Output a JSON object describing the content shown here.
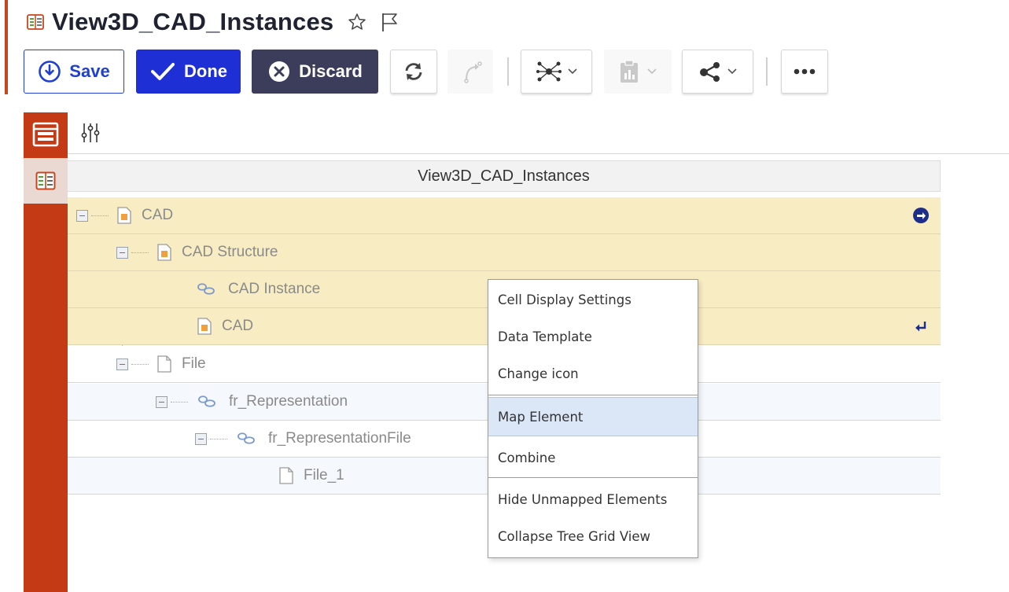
{
  "header": {
    "title": "View3D_CAD_Instances"
  },
  "toolbar": {
    "save_label": "Save",
    "done_label": "Done",
    "discard_label": "Discard"
  },
  "grid": {
    "column_header": "View3D_CAD_Instances",
    "rows": [
      {
        "label": "CAD",
        "level": 0,
        "icon": "cad-file-icon",
        "style": "yellow",
        "action": "navigate-circle-icon"
      },
      {
        "label": "CAD Structure",
        "level": 1,
        "icon": "cad-file-icon",
        "style": "yellow"
      },
      {
        "label": "CAD Instance",
        "level": 2,
        "icon": "relationship-icon",
        "style": "yellow"
      },
      {
        "label": "CAD",
        "level": 2,
        "icon": "cad-file-icon",
        "style": "yellow",
        "action": "return-arrow-icon"
      },
      {
        "label": "File",
        "level": 1,
        "icon": "file-icon",
        "style": "white"
      },
      {
        "label": "fr_Representation",
        "level": 2,
        "icon": "relationship-icon",
        "style": "blue"
      },
      {
        "label": "fr_RepresentationFile",
        "level": 3,
        "icon": "relationship-icon",
        "style": "white"
      },
      {
        "label": "File_1",
        "level": 4,
        "icon": "file-icon",
        "style": "blue"
      }
    ]
  },
  "context_menu": {
    "items": [
      {
        "label": "Cell Display Settings"
      },
      {
        "label": "Data Template"
      },
      {
        "label": "Change icon"
      },
      {
        "label": "Map Element",
        "active": true
      },
      {
        "label": "Combine"
      },
      {
        "label": "Hide Unmapped Elements"
      },
      {
        "label": "Collapse Tree Grid View"
      }
    ]
  },
  "colors": {
    "accent": "#c43a14",
    "primary": "#1e2fd6",
    "discard": "#3c3d5a",
    "highlight_row": "#f8ecc3",
    "menu_active": "#dbe6f7"
  }
}
